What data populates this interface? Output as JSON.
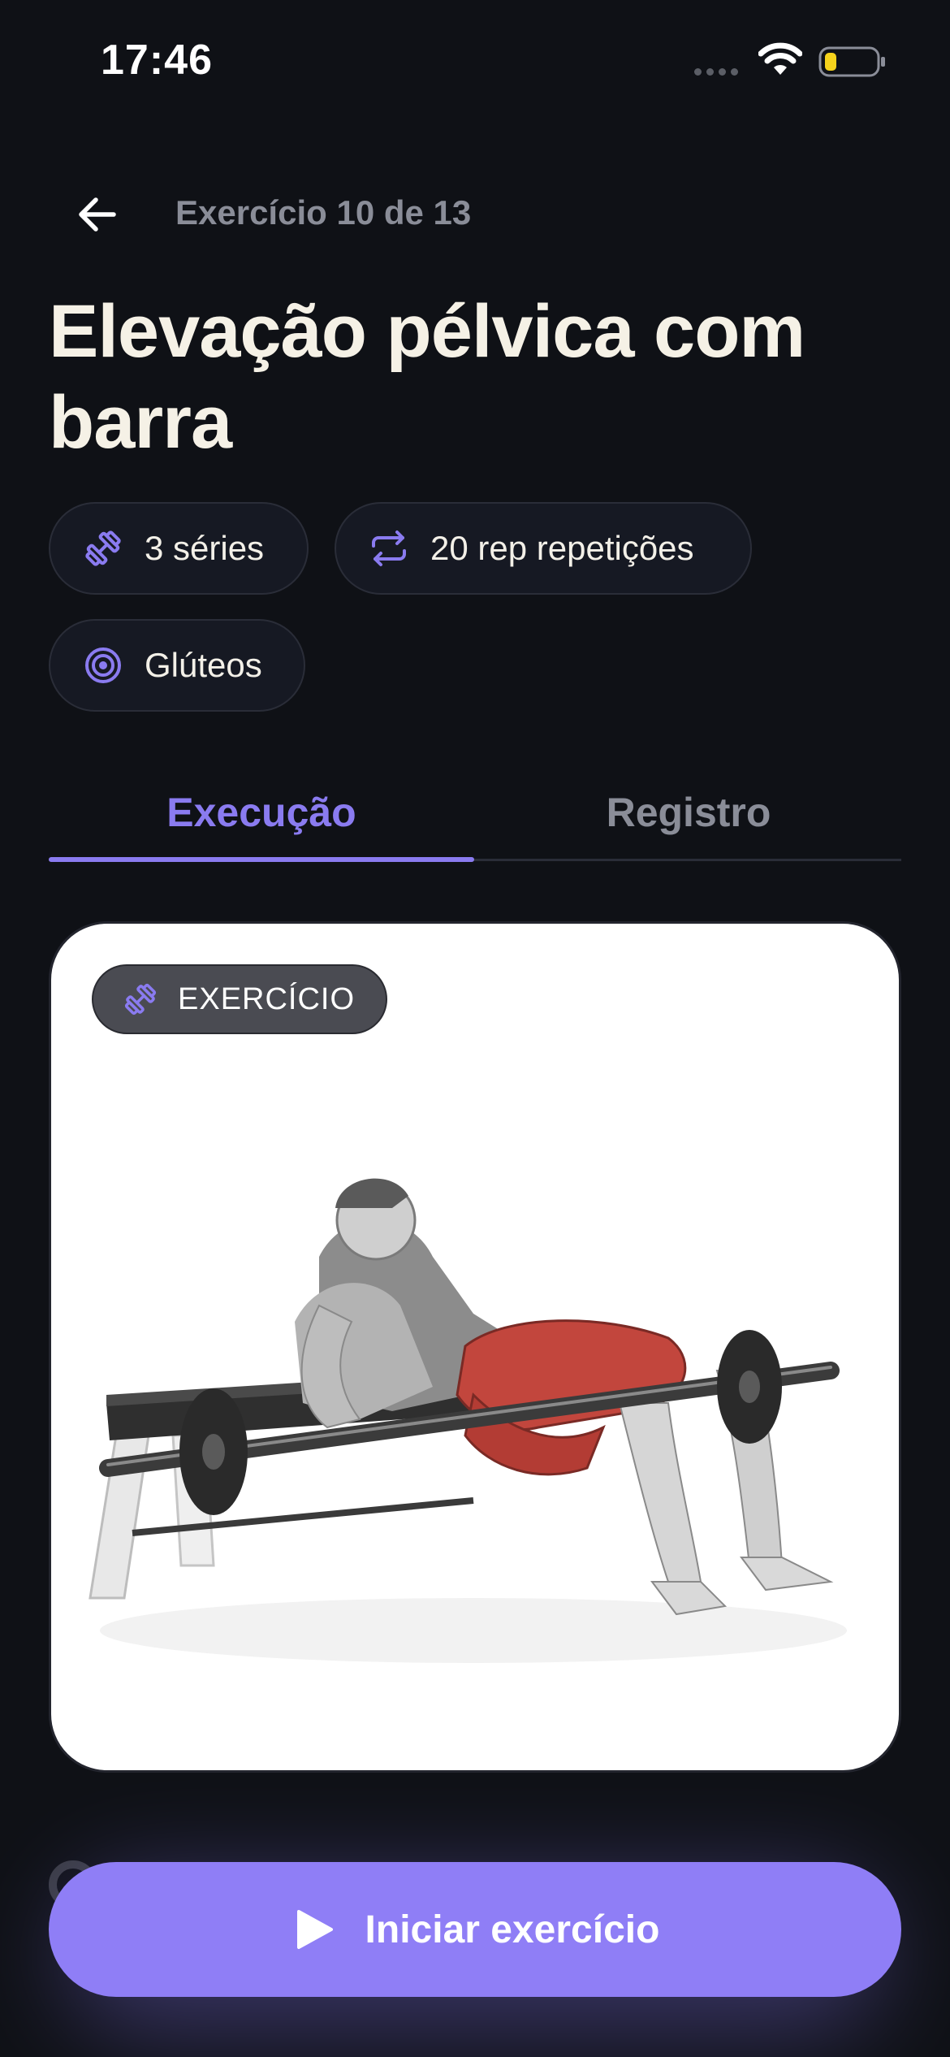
{
  "status_bar": {
    "time": "17:46"
  },
  "header": {
    "counter": "Exercício 10 de 13"
  },
  "exercise": {
    "title": "Elevação pélvica com barra",
    "chips": {
      "series": "3 séries",
      "reps": "20 rep repetições",
      "muscle": "Glúteos"
    }
  },
  "tabs": [
    {
      "label": "Execução",
      "active": true
    },
    {
      "label": "Registro",
      "active": false
    }
  ],
  "card": {
    "badge": "EXERCÍCIO"
  },
  "cta": {
    "label": "Iniciar exercício"
  },
  "colors": {
    "background": "#0f1116",
    "accent": "#8a7bf0",
    "cta": "#8f7ef6",
    "muted_text": "#8a8d98",
    "title_text": "#f5f1e6",
    "chip_bg": "#161923"
  },
  "icons": {
    "back": "arrow-left-icon",
    "series": "dumbbell-icon",
    "reps": "repeat-icon",
    "muscle": "target-icon",
    "cta": "play-icon"
  }
}
